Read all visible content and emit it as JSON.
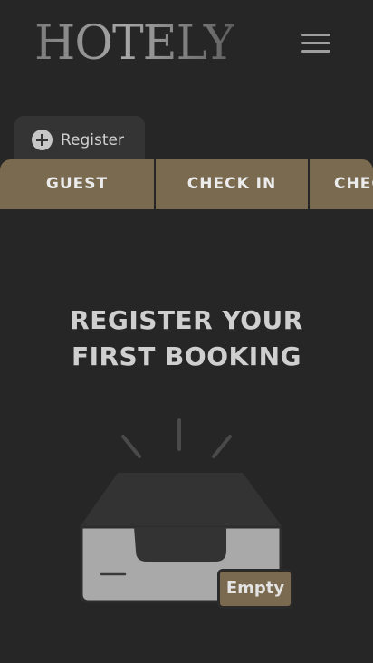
{
  "header": {
    "logo": "HOTELY",
    "menu_icon": "hamburger-menu-icon"
  },
  "register_tab": {
    "label": "Register",
    "icon": "plus-circle-icon"
  },
  "tabs": [
    {
      "label": "GUEST"
    },
    {
      "label": "CHECK IN"
    },
    {
      "label": "CHECK OUT"
    }
  ],
  "empty_state": {
    "headline_line1": "REGISTER YOUR",
    "headline_line2": "FIRST BOOKING",
    "illustration_icon": "empty-inbox-tray-icon",
    "badge": "Empty"
  },
  "colors": {
    "background": "#262626",
    "accent": "#7a6a4f",
    "text_light": "#cfcfcf"
  }
}
